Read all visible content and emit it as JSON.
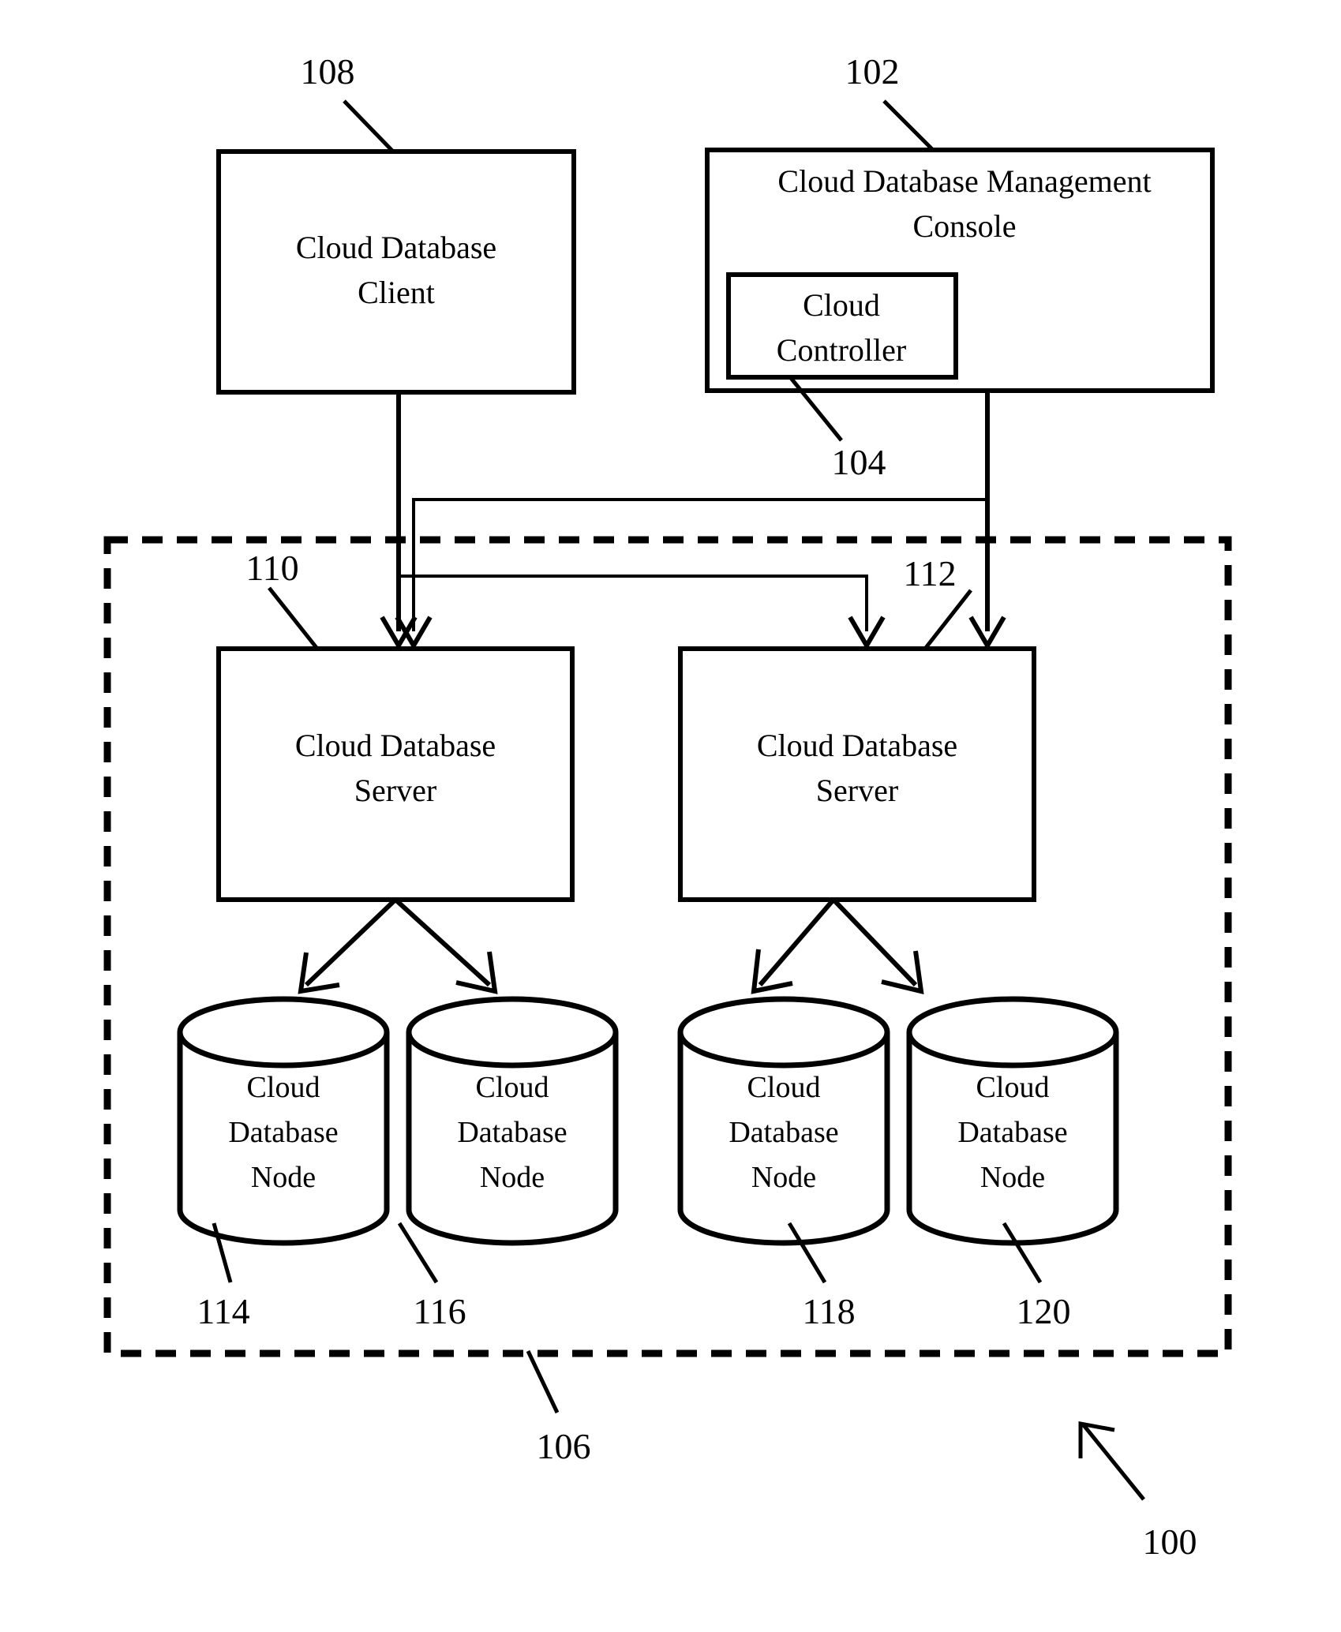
{
  "figure": {
    "type": "patent-block-diagram",
    "overall_ref": "100"
  },
  "blocks": {
    "client": {
      "ref": "108",
      "line1": "Cloud Database",
      "line2": "Client"
    },
    "console": {
      "ref": "102",
      "line1": "Cloud Database Management",
      "line2": "Console"
    },
    "controller": {
      "ref": "104",
      "line1": "Cloud",
      "line2": "Controller"
    },
    "server_left": {
      "ref": "110",
      "line1": "Cloud Database",
      "line2": "Server"
    },
    "server_right": {
      "ref": "112",
      "line1": "Cloud Database",
      "line2": "Server"
    },
    "cloud_boundary": {
      "ref": "106"
    }
  },
  "nodes": [
    {
      "ref": "114",
      "line1": "Cloud",
      "line2": "Database",
      "line3": "Node"
    },
    {
      "ref": "116",
      "line1": "Cloud",
      "line2": "Database",
      "line3": "Node"
    },
    {
      "ref": "118",
      "line1": "Cloud",
      "line2": "Database",
      "line3": "Node"
    },
    {
      "ref": "120",
      "line1": "Cloud",
      "line2": "Database",
      "line3": "Node"
    }
  ],
  "colors": {
    "stroke": "#000000",
    "background": "#ffffff"
  }
}
